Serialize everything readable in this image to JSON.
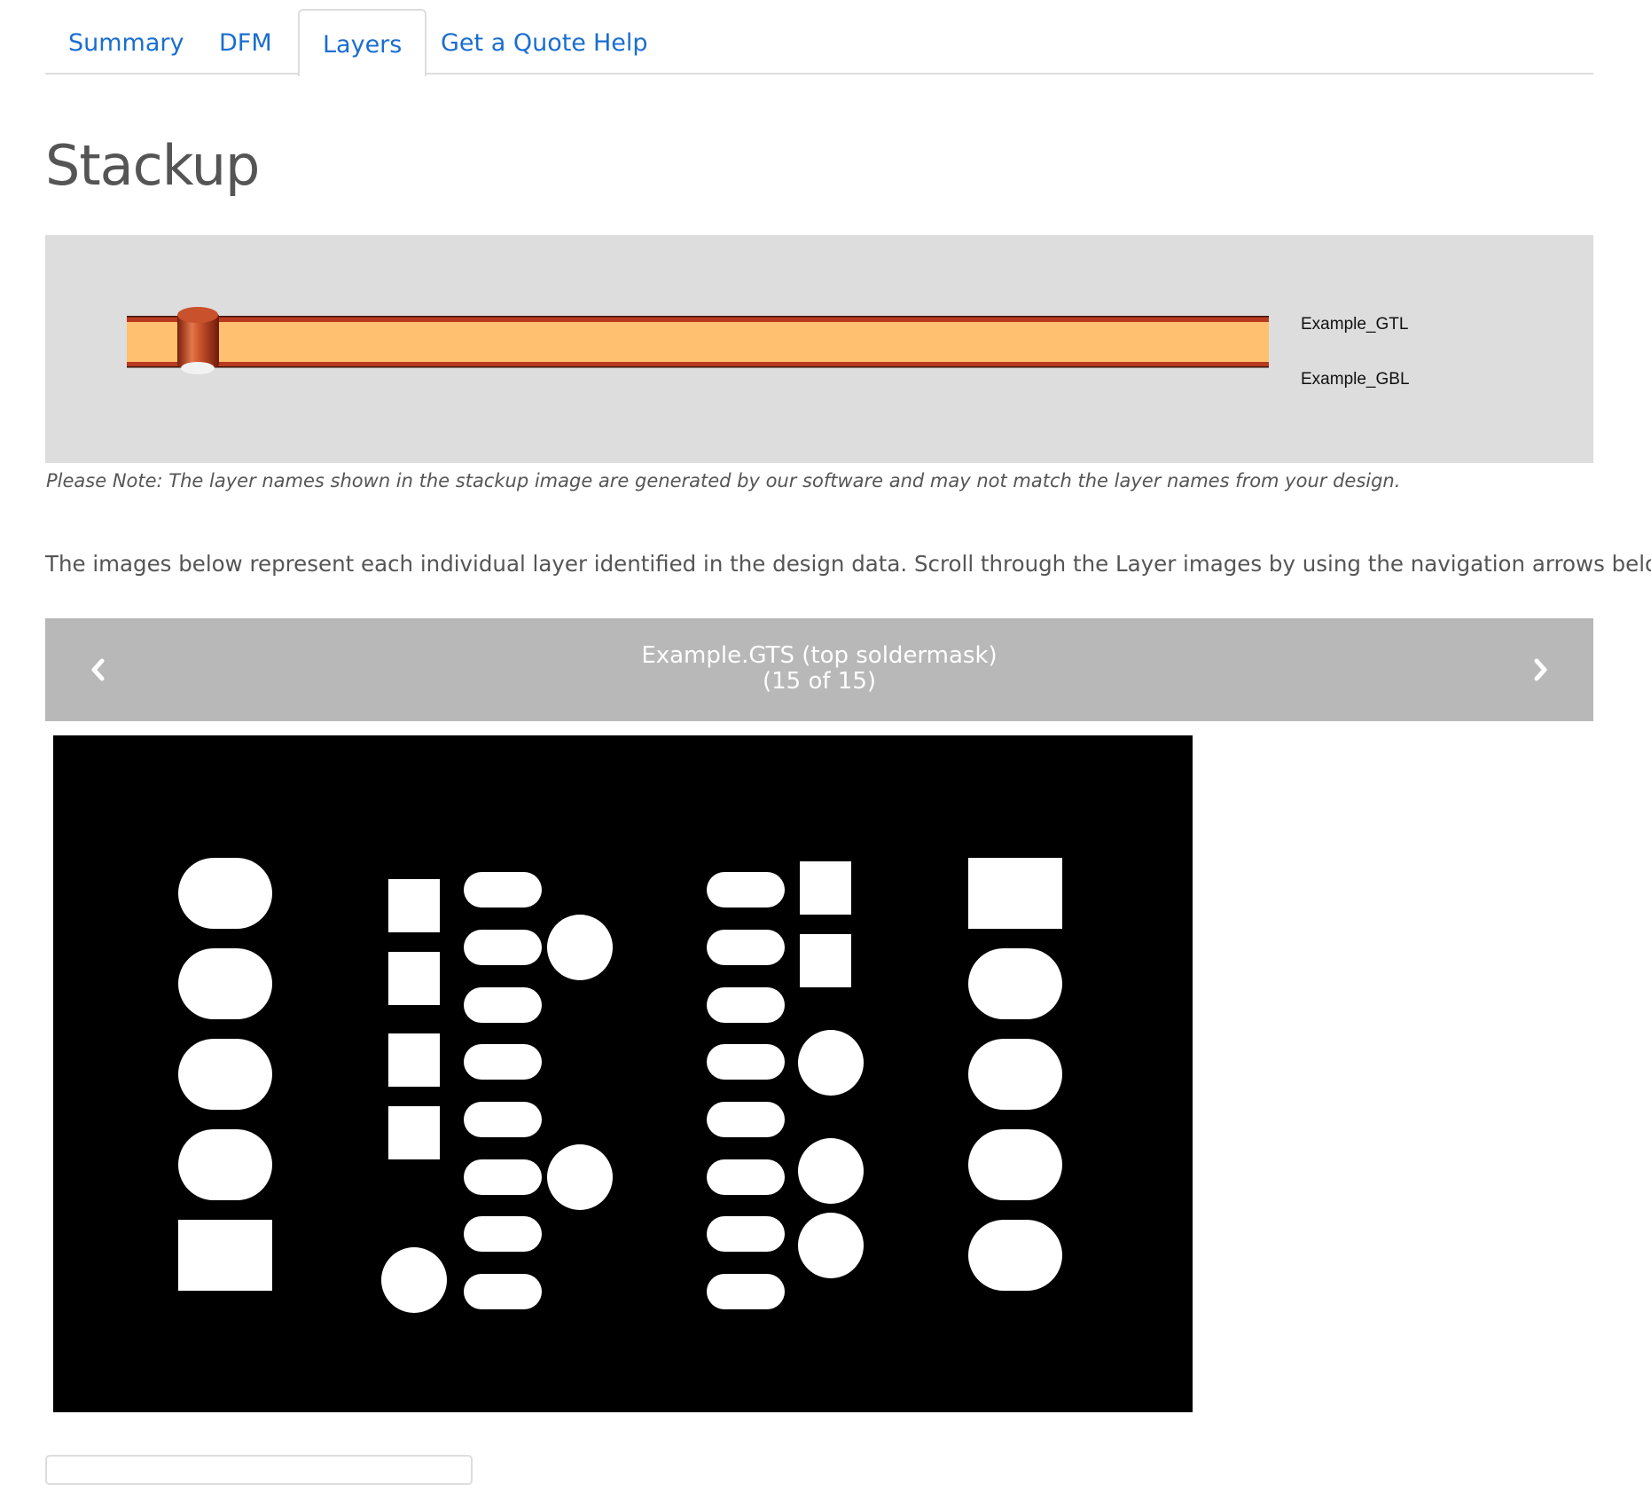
{
  "tabs": [
    {
      "label": "Summary",
      "active": false
    },
    {
      "label": "DFM",
      "active": false
    },
    {
      "label": "Layers",
      "active": true
    },
    {
      "label": "Get a Quote",
      "active": false
    },
    {
      "label": "Help",
      "active": false
    }
  ],
  "heading": "Stackup",
  "stackup": {
    "layers": [
      "Example_GTL",
      "Example_GBL"
    ]
  },
  "note": "Please Note: The layer names shown in the stackup image are generated by our software and may not match the layer names from your design.",
  "intro": "The images below represent each individual layer identified in the design data. Scroll through the Layer images by using the navigation arrows below.",
  "layer_viewer": {
    "layer_name": "Example.GTS (top soldermask)",
    "position_text": "(15 of 15)",
    "prev_icon": "chevron-left-icon",
    "next_icon": "chevron-right-icon"
  },
  "colors": {
    "tab_link": "#1a6ed0",
    "stackup_core": "#ffc06f",
    "copper": "#b83a1f",
    "nav_bar": "#b8b8b8"
  }
}
